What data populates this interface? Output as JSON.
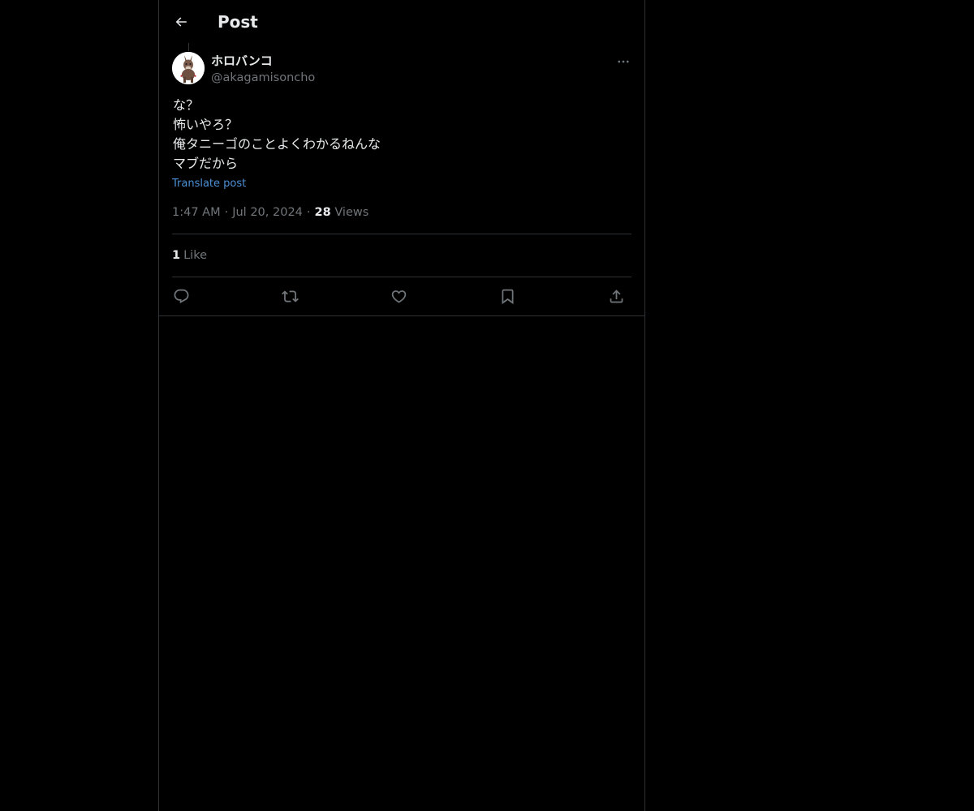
{
  "header": {
    "title": "Post",
    "back_icon": "arrow-left-icon"
  },
  "author": {
    "display_name": "ホロバンコ",
    "handle": "@akagamisoncho",
    "avatar_icon": "donkey-avatar"
  },
  "post": {
    "lines": [
      "な？",
      "怖いやろ？",
      "俺タニーゴのことよくわかるねんな",
      "マブだから"
    ],
    "translate_label": "Translate post"
  },
  "meta": {
    "time": "1:47 AM",
    "date": "Jul 20, 2024",
    "views_count": "28",
    "views_label": "Views"
  },
  "engagement": {
    "likes_count": "1",
    "likes_label": "Like"
  },
  "actions": [
    {
      "name": "reply",
      "icon": "reply-icon"
    },
    {
      "name": "repost",
      "icon": "repost-icon"
    },
    {
      "name": "like",
      "icon": "heart-icon"
    },
    {
      "name": "bookmark",
      "icon": "bookmark-icon"
    },
    {
      "name": "share",
      "icon": "share-icon"
    }
  ],
  "colors": {
    "background": "#000000",
    "text_primary": "#e7e9ea",
    "text_secondary": "#71767b",
    "link": "#4c8fd6",
    "border": "#2f3336"
  }
}
